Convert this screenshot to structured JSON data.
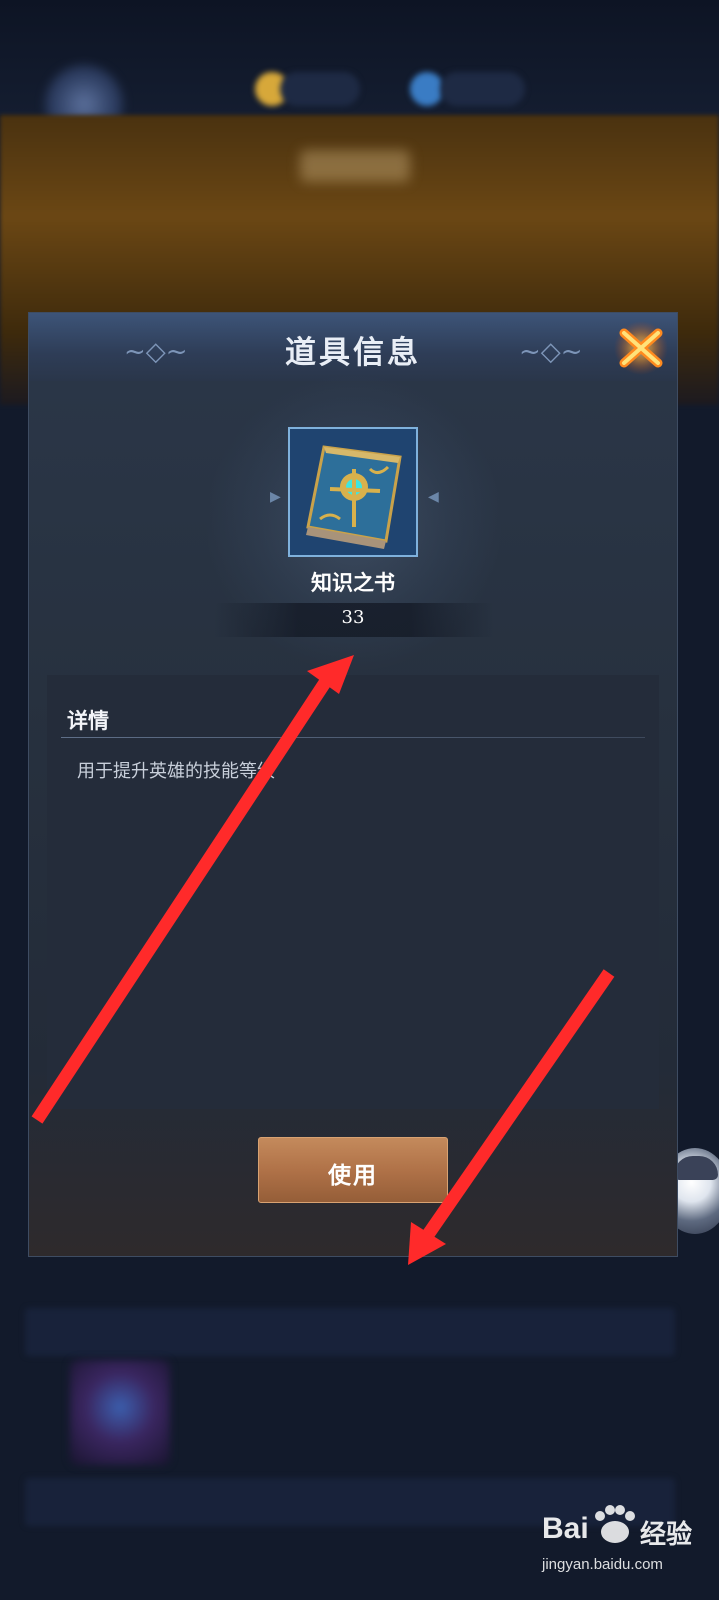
{
  "dialog": {
    "title": "道具信息",
    "item": {
      "name": "知识之书",
      "count": "33",
      "icon": "blue-book-icon"
    },
    "details": {
      "heading": "详情",
      "description": "用于提升英雄的技能等级"
    },
    "use_button": "使用",
    "close_icon": "close-icon"
  },
  "watermark": {
    "brand": "Bai",
    "brand2": "经验",
    "url": "jingyan.baidu.com"
  },
  "colors": {
    "accent_button": "#b07248",
    "close_orange": "#ff8a1e",
    "annotation_red": "#ff2a2a"
  }
}
